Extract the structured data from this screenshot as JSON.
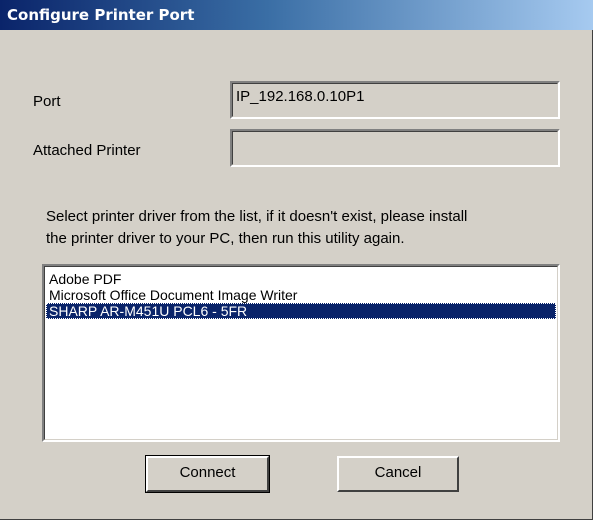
{
  "dialog": {
    "title": "Configure Printer Port"
  },
  "form": {
    "port_label": "Port",
    "port_value": "IP_192.168.0.10P1",
    "attached_printer_label": "Attached Printer",
    "attached_printer_value": ""
  },
  "instructions": {
    "line1": "Select printer driver from the list, if it doesn't exist, please install",
    "line2": "the printer driver to your PC, then run this utility again."
  },
  "driver_list": {
    "items": [
      {
        "label": "Adobe PDF",
        "selected": false
      },
      {
        "label": "Microsoft Office Document Image Writer",
        "selected": false
      },
      {
        "label": "SHARP AR-M451U PCL6 - 5FR",
        "selected": true
      }
    ]
  },
  "buttons": {
    "connect_label": "Connect",
    "cancel_label": "Cancel"
  },
  "colors": {
    "title_bar_start": "#0a246a",
    "title_bar_end": "#a6caf0",
    "dialog_bg": "#d4d0c8",
    "selection_bg": "#0a246a"
  }
}
